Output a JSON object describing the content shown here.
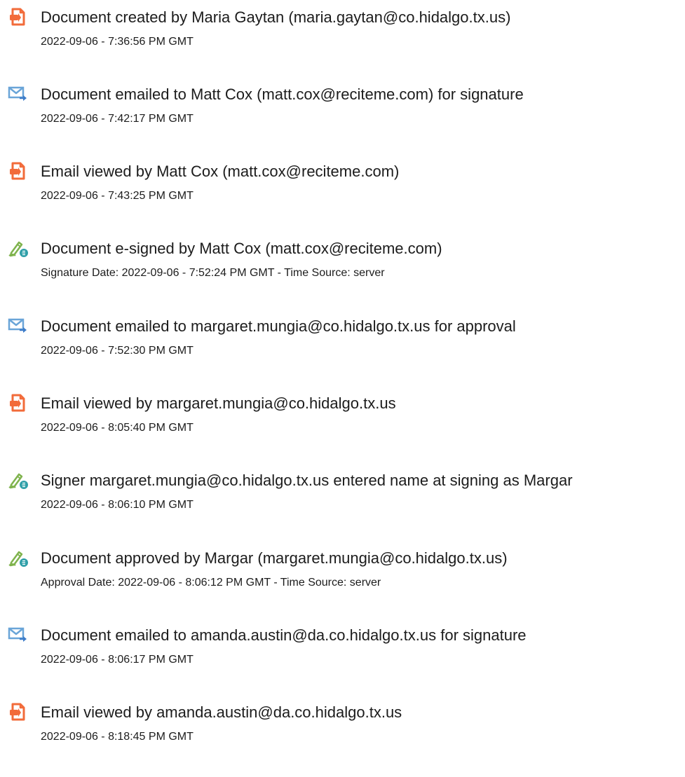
{
  "events": [
    {
      "icon": "document-created-icon",
      "title": "Document created by Maria Gaytan (maria.gaytan@co.hidalgo.tx.us)",
      "meta": "2022-09-06 - 7:36:56 PM GMT"
    },
    {
      "icon": "email-sent-icon",
      "title": "Document emailed to Matt Cox (matt.cox@reciteme.com) for signature",
      "meta": "2022-09-06 - 7:42:17 PM GMT"
    },
    {
      "icon": "document-viewed-icon",
      "title": "Email viewed by Matt Cox (matt.cox@reciteme.com)",
      "meta": "2022-09-06 - 7:43:25 PM GMT"
    },
    {
      "icon": "e-sign-icon",
      "title": "Document e-signed by Matt Cox (matt.cox@reciteme.com)",
      "meta": "Signature Date: 2022-09-06 - 7:52:24 PM GMT - Time Source: server"
    },
    {
      "icon": "email-sent-icon",
      "title": "Document emailed to margaret.mungia@co.hidalgo.tx.us for approval",
      "meta": "2022-09-06 - 7:52:30 PM GMT"
    },
    {
      "icon": "document-viewed-icon",
      "title": "Email viewed by margaret.mungia@co.hidalgo.tx.us",
      "meta": "2022-09-06 - 8:05:40 PM GMT"
    },
    {
      "icon": "e-sign-icon",
      "title": "Signer margaret.mungia@co.hidalgo.tx.us entered name at signing as Margar",
      "meta": "2022-09-06 - 8:06:10 PM GMT"
    },
    {
      "icon": "e-sign-icon",
      "title": "Document approved by Margar (margaret.mungia@co.hidalgo.tx.us)",
      "meta": "Approval Date: 2022-09-06 - 8:06:12 PM GMT - Time Source: server"
    },
    {
      "icon": "email-sent-icon",
      "title": "Document emailed to amanda.austin@da.co.hidalgo.tx.us for signature",
      "meta": "2022-09-06 - 8:06:17 PM GMT"
    },
    {
      "icon": "document-viewed-icon",
      "title": "Email viewed by amanda.austin@da.co.hidalgo.tx.us",
      "meta": "2022-09-06 - 8:18:45 PM GMT"
    }
  ],
  "colors": {
    "doc_icon": "#f26b3a",
    "mail_icon": "#6aa5d8",
    "mail_arrow": "#3d7cc9",
    "sign_icon": "#7fb34d",
    "sign_badge": "#2f9fa8"
  }
}
